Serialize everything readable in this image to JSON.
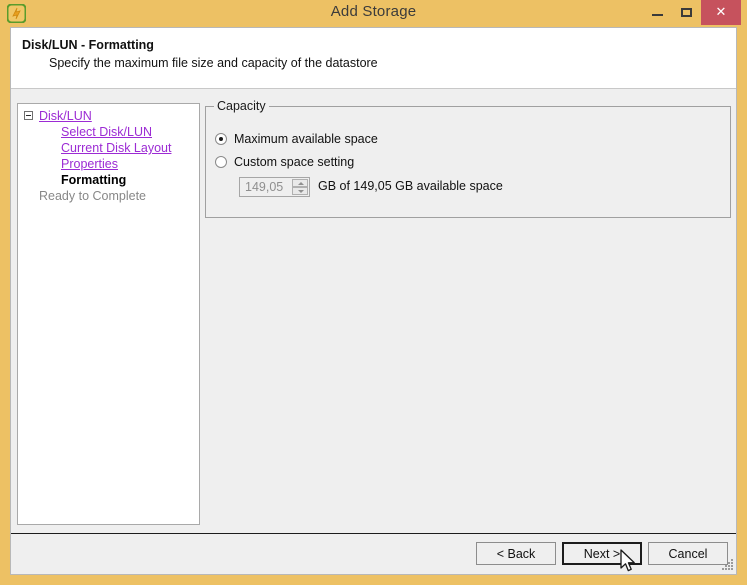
{
  "window": {
    "title": "Add Storage",
    "app_icon": "chain-link-icon",
    "controls": {
      "minimize": "minimize-icon",
      "maximize": "maximize-icon",
      "close": "✕"
    },
    "frame_color": "#edc164",
    "close_button_color": "#c6525d"
  },
  "header": {
    "title": "Disk/LUN - Formatting",
    "subtitle": "Specify the maximum file size and capacity of the datastore"
  },
  "sidebar": {
    "items": [
      {
        "label": "Disk/LUN",
        "state": "link",
        "level": 0,
        "expander": true
      },
      {
        "label": "Select Disk/LUN",
        "state": "link",
        "level": 1
      },
      {
        "label": "Current Disk Layout",
        "state": "link",
        "level": 1
      },
      {
        "label": "Properties",
        "state": "link",
        "level": 1
      },
      {
        "label": "Formatting",
        "state": "current",
        "level": 1
      },
      {
        "label": "Ready to Complete",
        "state": "disabled",
        "level": 0
      }
    ],
    "link_color": "#9c2bd4",
    "disabled_color": "#888888"
  },
  "capacity": {
    "legend": "Capacity",
    "options": [
      {
        "label": "Maximum available space",
        "selected": true
      },
      {
        "label": "Custom space setting",
        "selected": false
      }
    ],
    "spinner": {
      "value": "149,05",
      "enabled": false,
      "up_icon": "chevron-up-icon",
      "down_icon": "chevron-down-icon"
    },
    "note": "GB of 149,05 GB available space"
  },
  "footer": {
    "back_label": "< Back",
    "next_label": "Next >",
    "cancel_label": "Cancel",
    "default_button": "Next >"
  }
}
